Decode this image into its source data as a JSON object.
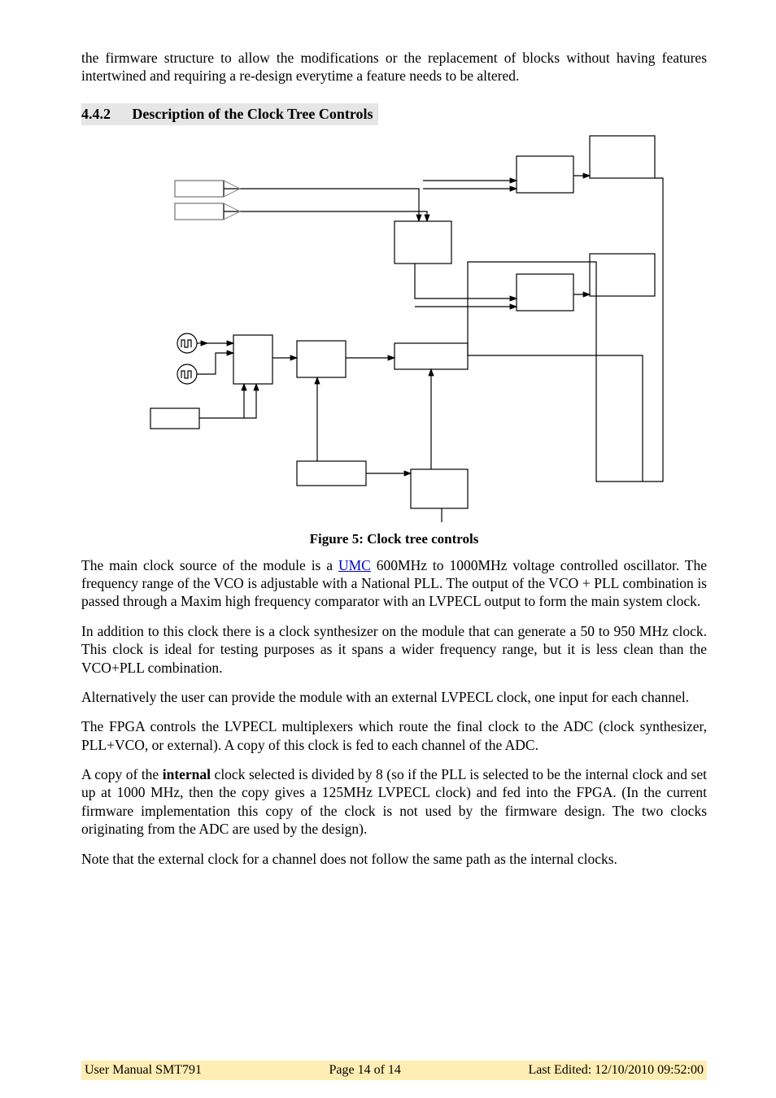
{
  "intro_para": "the firmware structure to allow the modifications or the replacement of blocks without having features intertwined and requiring a re-design everytime a feature needs to be altered.",
  "section": {
    "number": "4.4.2",
    "title": "Description of the Clock Tree Controls"
  },
  "figure_caption": "Figure 5: Clock tree controls",
  "p1_a": "The main clock source of the module is a ",
  "p1_link": "UMC",
  "p1_b": " 600MHz to 1000MHz voltage controlled oscillator. The frequency range of the VCO is adjustable with a National PLL. The output of the VCO + PLL combination is passed through a Maxim high frequency comparator with an LVPECL output to form the main system clock.",
  "p2": "In addition to this clock there is a clock synthesizer on the module that can generate a 50 to 950 MHz clock. This clock is ideal for testing purposes as it spans a wider frequency range, but it is less clean than the VCO+PLL combination.",
  "p3": "Alternatively the user can provide the module with an external LVPECL clock, one input for each channel.",
  "p4": "The FPGA controls the LVPECL multiplexers which route the final clock to the ADC (clock synthesizer, PLL+VCO, or external). A copy of this clock is fed to each channel of the ADC.",
  "p5_a": "A copy of the ",
  "p5_bold": "internal",
  "p5_b": " clock selected is divided by 8 (so if the PLL is selected to be the internal clock and set up at 1000 MHz, then the copy gives a 125MHz LVPECL clock) and fed into the FPGA. (In the current firmware implementation this copy of the clock is not used by the firmware design. The two clocks originating from the ADC are used by the design).",
  "p6": "Note that the external clock for a channel does not follow the same path as the internal clocks.",
  "footer": {
    "left": "User Manual SMT791",
    "center": "Page 14 of 14",
    "right": "Last Edited: 12/10/2010 09:52:00"
  }
}
